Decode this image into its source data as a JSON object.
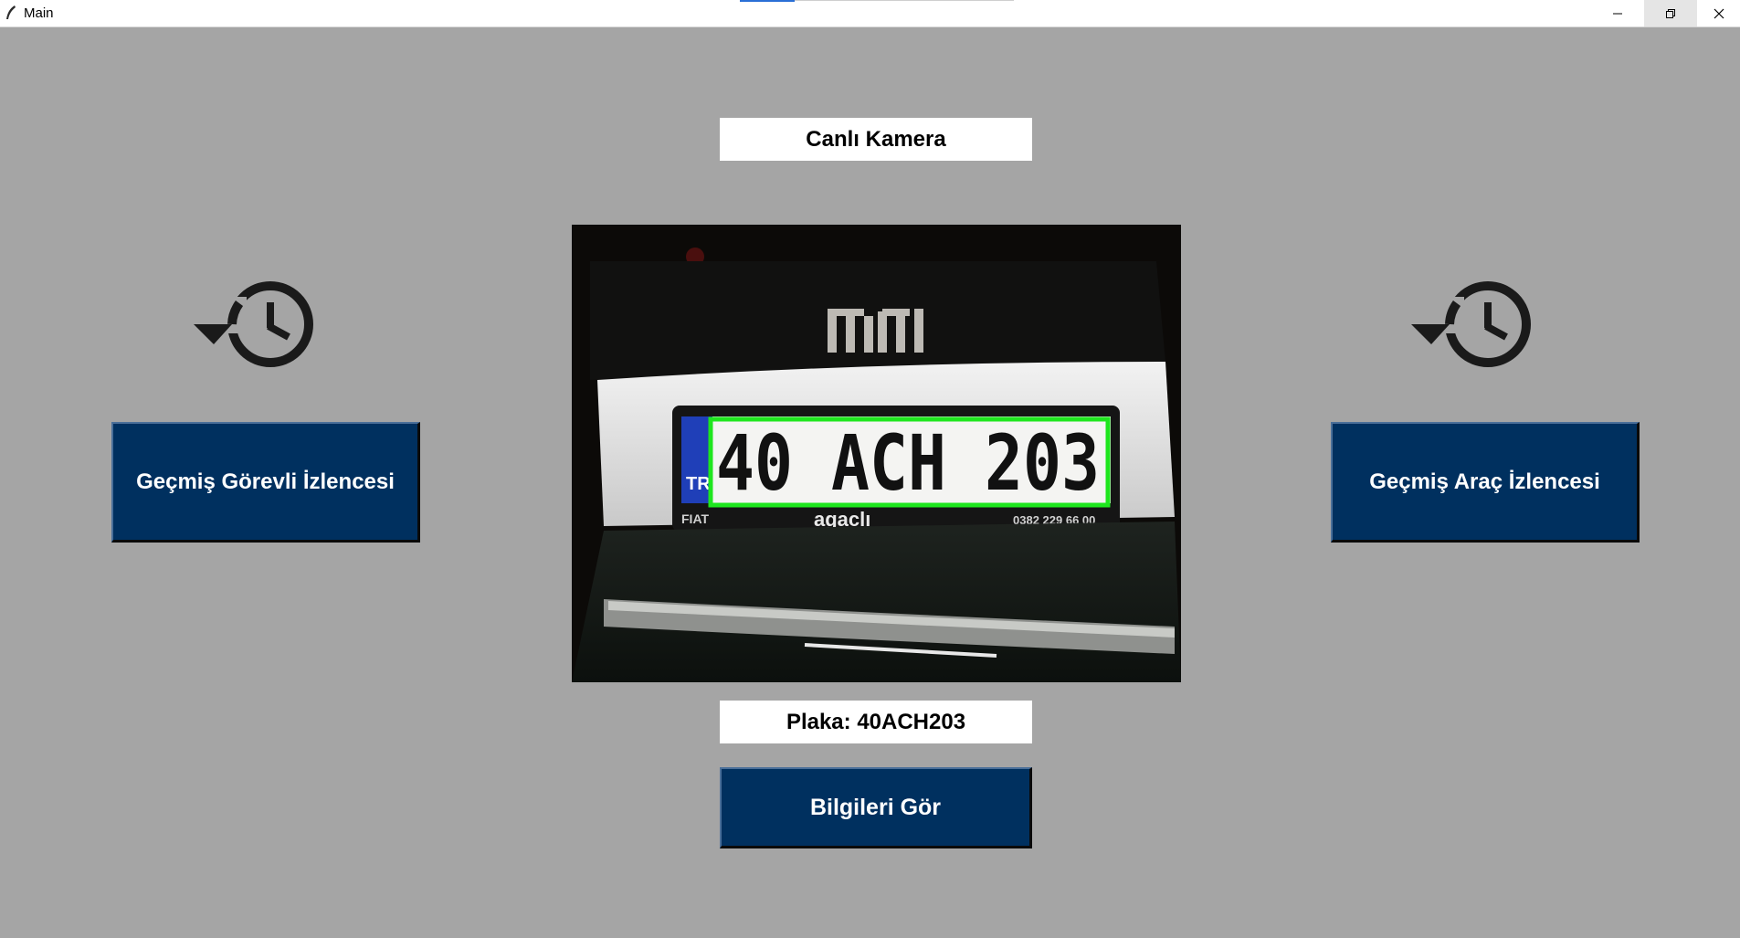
{
  "window": {
    "title": "Main",
    "app_icon": "feather-icon",
    "controls": [
      "minimize-icon",
      "restore-icon",
      "close-icon"
    ]
  },
  "camera": {
    "title": "Canlı Kamera"
  },
  "plate": {
    "label": "Plaka: 40ACH203",
    "image_text": {
      "plate_number": "40 ACH 203",
      "country_code": "TR",
      "car_badge": "FIAT",
      "dealer": "agaclı",
      "phone": "0382 229 66 00"
    },
    "highlight_color": "#1ee61e"
  },
  "buttons": {
    "left": "Geçmiş Görevli İzlencesi",
    "right": "Geçmiş Araç İzlencesi",
    "info": "Bilgileri Gör"
  },
  "icons": {
    "left": "history-icon",
    "right": "history-icon"
  },
  "colors": {
    "background": "#a5a5a5",
    "button": "#00305f",
    "button_text": "#ffffff"
  }
}
